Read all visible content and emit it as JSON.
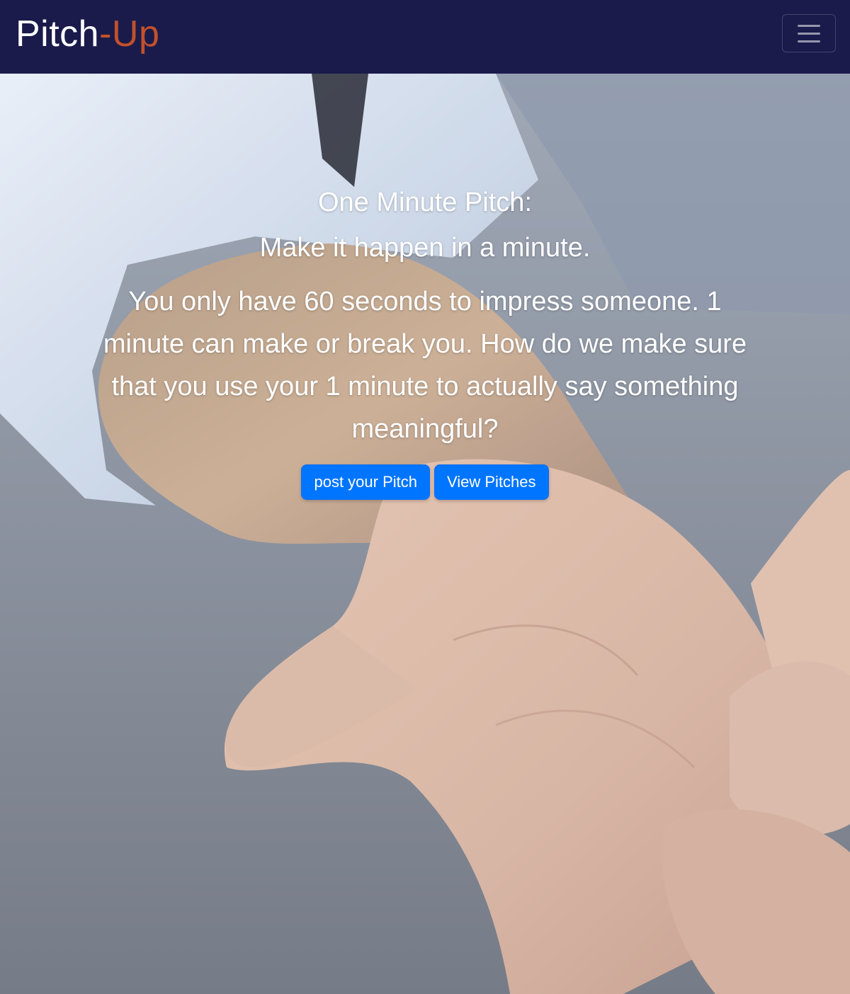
{
  "navbar": {
    "brand_main": "Pitch",
    "brand_accent": "-Up",
    "background_color": "#1a1b4b",
    "accent_color": "#c2512b",
    "menu_icon": "hamburger-icon"
  },
  "hero": {
    "title": "One Minute Pitch:",
    "subtitle": "Make it happen in a minute.",
    "text": "You only have 60 seconds to impress someone. 1 minute can make or break you. How do we make sure that you use your 1 minute to actually say something meaningful?",
    "buttons": {
      "post_label": "post your Pitch",
      "view_label": "View Pitches"
    },
    "button_color": "#0075ff"
  }
}
